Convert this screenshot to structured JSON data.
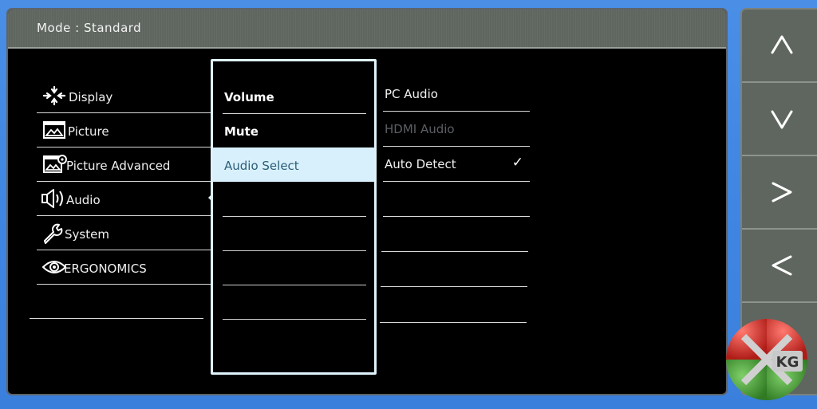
{
  "header": {
    "mode_text": "Mode : Standard"
  },
  "main_menu": [
    {
      "label": "Display",
      "icon": "display-icon"
    },
    {
      "label": "Picture",
      "icon": "picture-icon"
    },
    {
      "label": "Picture Advanced",
      "icon": "picture-advanced-icon"
    },
    {
      "label": "Audio",
      "icon": "speaker-icon",
      "active": true
    },
    {
      "label": "System",
      "icon": "wrench-icon"
    },
    {
      "label": "ERGONOMICS",
      "icon": "eye-icon"
    },
    {
      "label": ""
    }
  ],
  "audio_menu": [
    {
      "label": "Volume"
    },
    {
      "label": "Mute"
    },
    {
      "label": "Audio Select",
      "selected": true
    },
    {
      "label": ""
    },
    {
      "label": ""
    },
    {
      "label": ""
    },
    {
      "label": ""
    }
  ],
  "audio_select_options": [
    {
      "label": "PC Audio",
      "enabled": true,
      "checked": false
    },
    {
      "label": "HDMI Audio",
      "enabled": false,
      "checked": false
    },
    {
      "label": "Auto Detect",
      "enabled": true,
      "checked": true
    },
    {
      "label": ""
    },
    {
      "label": ""
    },
    {
      "label": ""
    },
    {
      "label": ""
    }
  ],
  "check_glyph": "✓",
  "control_buttons": [
    {
      "name": "up",
      "icon": "chevron-up-icon"
    },
    {
      "name": "down",
      "icon": "chevron-down-icon"
    },
    {
      "name": "right",
      "icon": "chevron-right-icon"
    },
    {
      "name": "left",
      "icon": "chevron-left-icon"
    }
  ],
  "watermark": {
    "text": "KG",
    "colors": [
      "#e0342d",
      "#4a9a3a",
      "#c9c9c9"
    ]
  },
  "colors": {
    "background": "#3f86e2",
    "osd_bg": "#000000",
    "header_bg": "#5f665f",
    "highlight": "#d7f0fb",
    "highlight_text": "#2d5d78",
    "disabled_text": "#5b5f64"
  }
}
